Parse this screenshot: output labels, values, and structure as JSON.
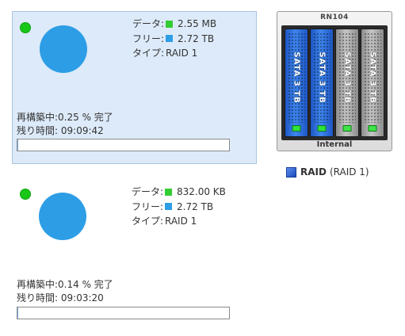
{
  "volumes": [
    {
      "status_color": "#19c719",
      "info": {
        "data_label": "データ:",
        "data_value": "2.55 MB",
        "data_color": "#33cc33",
        "free_label": "フリー:",
        "free_value": "2.72 TB",
        "free_color": "#2d9ee6",
        "type_label": "タイプ:",
        "type_value": "RAID 1"
      },
      "rebuild": {
        "label": "再構築中:",
        "value": "0.25 % 完了",
        "remaining_label": "残り時間:",
        "remaining_value": "09:09:42",
        "progress": 0.0025
      }
    },
    {
      "status_color": "#19c719",
      "info": {
        "data_label": "データ:",
        "data_value": "832.00 KB",
        "data_color": "#33cc33",
        "free_label": "フリー:",
        "free_value": "2.72 TB",
        "free_color": "#2d9ee6",
        "type_label": "タイプ:",
        "type_value": "RAID 1"
      },
      "rebuild": {
        "label": "再構築中:",
        "value": "0.14 % 完了",
        "remaining_label": "残り時間:",
        "remaining_value": "09:03:20",
        "progress": 0.0014
      }
    }
  ],
  "device": {
    "model": "RN104",
    "footer": "Internal",
    "bays": [
      {
        "label": "SATA 3 TB",
        "color": "blue"
      },
      {
        "label": "SATA 3 TB",
        "color": "blue"
      },
      {
        "label": "SATA 3 TB",
        "color": "gray"
      },
      {
        "label": "SATA 3 TB",
        "color": "gray"
      }
    ]
  },
  "legend": {
    "name": "RAID",
    "detail": "(RAID 1)"
  }
}
